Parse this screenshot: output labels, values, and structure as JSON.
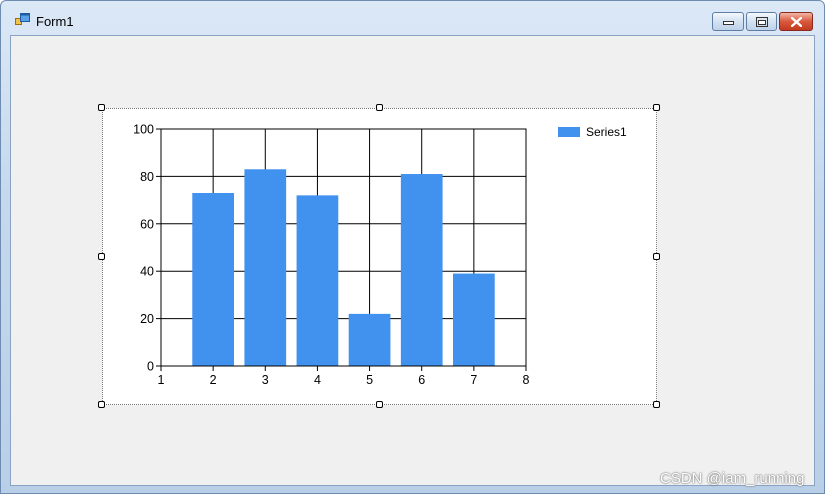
{
  "window": {
    "title": "Form1"
  },
  "controls": {
    "minimize": "minimize",
    "maximize": "maximize",
    "close": "close"
  },
  "legend": {
    "label": "Series1"
  },
  "colors": {
    "series": "#4191ef",
    "grid": "#000000",
    "client_bg": "#f0f0f0"
  },
  "chart_data": {
    "type": "bar",
    "series": [
      {
        "name": "Series1",
        "x": [
          2,
          3,
          4,
          5,
          6,
          7
        ],
        "values": [
          73,
          83,
          72,
          22,
          81,
          39
        ]
      }
    ],
    "xlim": [
      1,
      8
    ],
    "ylim": [
      0,
      100
    ],
    "xticks": [
      "1",
      "2",
      "3",
      "4",
      "5",
      "6",
      "7",
      "8"
    ],
    "yticks": [
      "0",
      "20",
      "40",
      "60",
      "80",
      "100"
    ],
    "grid": true,
    "legend_position": "top-right"
  },
  "watermark": "CSDN @iam_running"
}
